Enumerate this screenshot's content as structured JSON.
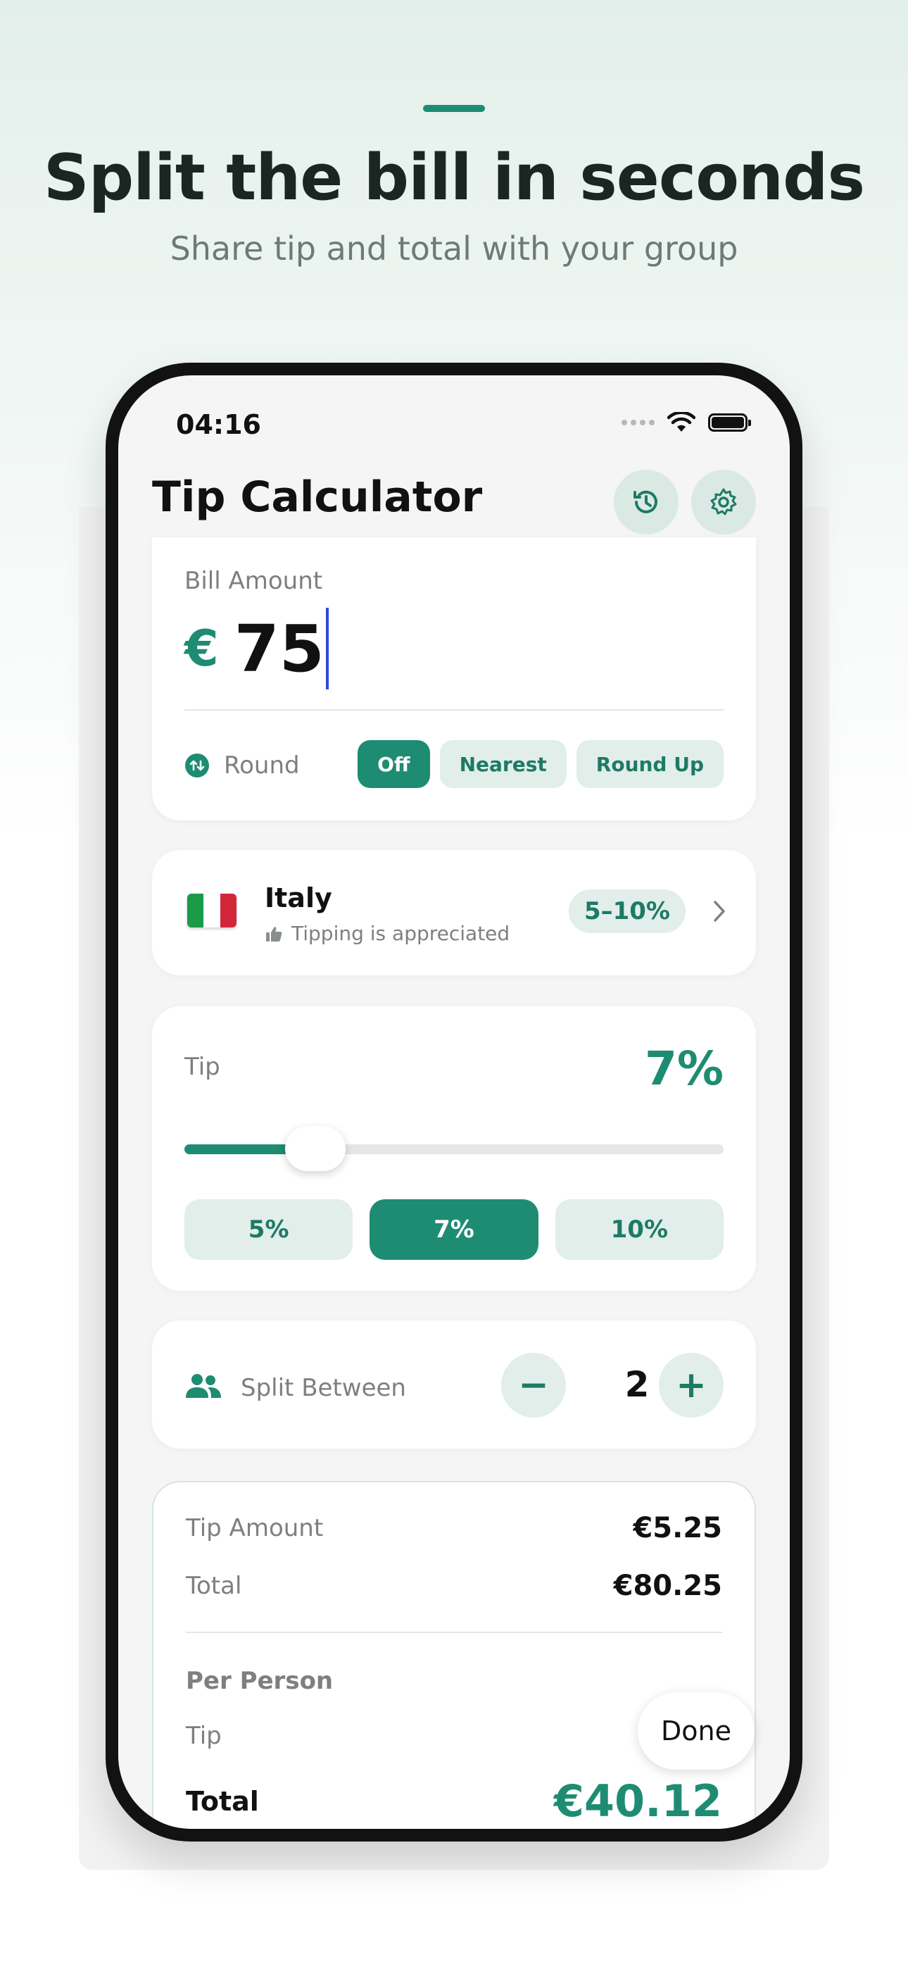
{
  "marketing": {
    "headline": "Split the bill in seconds",
    "subline": "Share tip and total with your group"
  },
  "status_bar": {
    "time": "04:16"
  },
  "header": {
    "title": "Tip Calculator",
    "history_icon": "history-icon",
    "settings_icon": "gear-icon"
  },
  "bill": {
    "label": "Bill Amount",
    "currency": "€",
    "value": "75",
    "round_label": "Round",
    "round_options": [
      "Off",
      "Nearest",
      "Round Up"
    ],
    "round_selected": "Off"
  },
  "country": {
    "name": "Italy",
    "note": "Tipping is appreciated",
    "range": "5–10%",
    "flag_colors": [
      "#1b9a48",
      "#ffffff",
      "#d3263a"
    ]
  },
  "tip": {
    "label": "Tip",
    "value": "7%",
    "slider_fraction": 0.2,
    "presets": [
      "5%",
      "7%",
      "10%"
    ],
    "selected": "7%"
  },
  "split": {
    "label": "Split Between",
    "count": "2",
    "minus": "−",
    "plus": "+"
  },
  "summary": {
    "tip_amount_label": "Tip Amount",
    "tip_amount": "€5.25",
    "total_label": "Total",
    "total": "€80.25",
    "per_person_label": "Per Person",
    "pp_tip_label": "Tip",
    "pp_total_label": "Total",
    "pp_total": "€40.12"
  },
  "keyboard_bar": {
    "done": "Done"
  },
  "colors": {
    "accent": "#1e8c72",
    "accent_soft": "#e1eeea"
  }
}
